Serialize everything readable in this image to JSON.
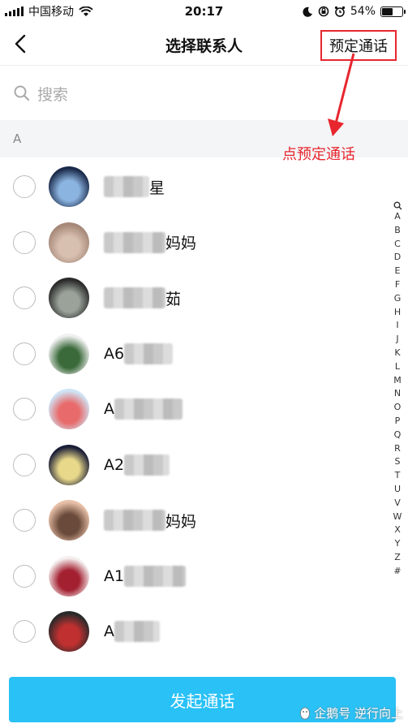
{
  "status_bar": {
    "carrier": "中国移动",
    "time": "20:17",
    "battery_percent": "54%",
    "battery_level": 0.54,
    "icons": [
      "signal-icon",
      "wifi-icon",
      "moon-icon",
      "rotation-lock-icon",
      "alarm-icon",
      "battery-icon"
    ]
  },
  "nav": {
    "title": "选择联系人",
    "action_label": "预定通话",
    "back_icon": "back-arrow-icon"
  },
  "search": {
    "placeholder": "搜索"
  },
  "annotation": {
    "text": "点预定通话",
    "color": "#e8262e"
  },
  "section": {
    "letter": "A"
  },
  "contacts": [
    {
      "prefix": "",
      "suffix": "星",
      "avatar_colors": [
        "#1b2a4a",
        "#8bb4e0"
      ]
    },
    {
      "prefix": "",
      "suffix": "妈妈",
      "avatar_colors": [
        "#a68878",
        "#d8c0b0"
      ]
    },
    {
      "prefix": "",
      "suffix": "茹",
      "avatar_colors": [
        "#2a2a2a",
        "#9aa29a"
      ]
    },
    {
      "prefix": "A6",
      "suffix": "",
      "avatar_colors": [
        "#f0f0f0",
        "#3a6a3a"
      ]
    },
    {
      "prefix": "A",
      "suffix": "",
      "avatar_colors": [
        "#cfe4f5",
        "#e86a6a"
      ]
    },
    {
      "prefix": "A2",
      "suffix": "",
      "avatar_colors": [
        "#1a1d36",
        "#e8d88a"
      ]
    },
    {
      "prefix": "",
      "suffix": "妈妈",
      "avatar_colors": [
        "#e8c0a8",
        "#6a4a3a"
      ]
    },
    {
      "prefix": "A1",
      "suffix": "",
      "avatar_colors": [
        "#f5f0f0",
        "#a32030"
      ]
    },
    {
      "prefix": "A",
      "suffix": "",
      "avatar_colors": [
        "#2a2a2a",
        "#c03030"
      ]
    }
  ],
  "index_letters": [
    "A",
    "B",
    "C",
    "D",
    "E",
    "F",
    "G",
    "H",
    "I",
    "J",
    "K",
    "L",
    "M",
    "N",
    "O",
    "P",
    "Q",
    "R",
    "S",
    "T",
    "U",
    "V",
    "W",
    "X",
    "Y",
    "Z",
    "#"
  ],
  "primary_button": {
    "label": "发起通话",
    "color": "#29c1f6"
  },
  "watermark": {
    "text": "企鹅号 逆行向上"
  }
}
